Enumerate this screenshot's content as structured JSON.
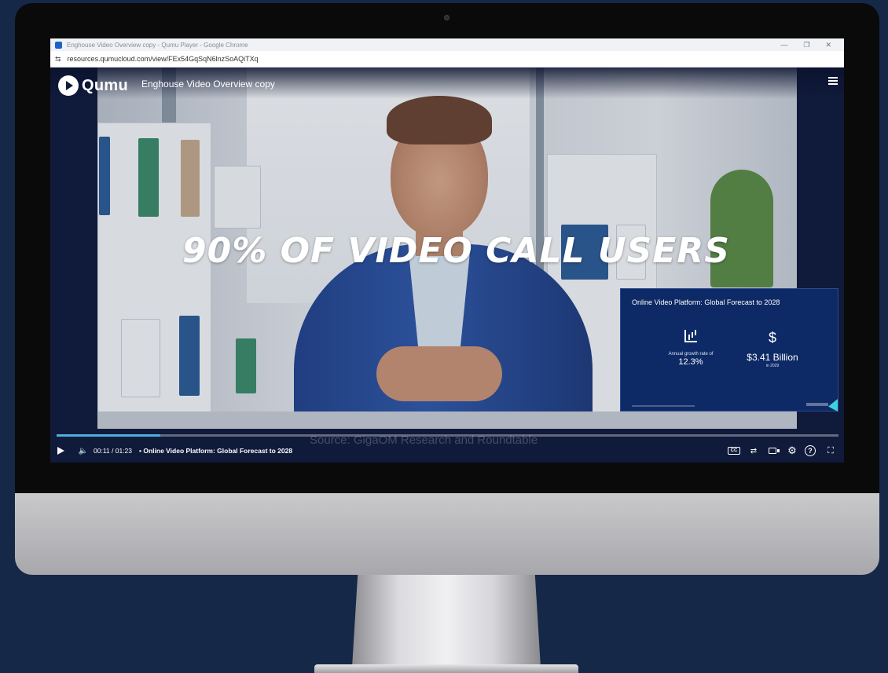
{
  "browser": {
    "window_title": "Enghouse Video Overview copy - Qumu Player - Google Chrome",
    "url": "resources.qumucloud.com/view/FEx54GqSqN6lnzSoAQiTXq",
    "controls": {
      "minimize": "—",
      "restore": "❐",
      "close": "✕"
    }
  },
  "player": {
    "logo_text": "Qumu",
    "video_title": "Enghouse Video Overview copy",
    "menu_icon": "hamburger-menu-icon",
    "overlay_headline": "90% OF VIDEO CALL USERS",
    "overlay_source": "Source: GigaOM Research and Roundtable",
    "progress_fraction": 0.133,
    "current_time": "00:11",
    "duration": "01:23",
    "time_display": "00:11 / 01:23",
    "chapter_separator": "•",
    "chapter_title": "Online Video Platform: Global Forecast to 2028",
    "controls": {
      "play": "play-icon",
      "volume": "🔈",
      "cc": "CC",
      "transcript": "⇄",
      "pip": "pip-icon",
      "settings": "⚙",
      "help": "?",
      "fullscreen": "⛶"
    }
  },
  "stat_card": {
    "title": "Online Video Platform: Global Forecast to 2028",
    "left": {
      "icon": "bar-chart-icon",
      "label": "Annual growth rate of",
      "value": "12.3%"
    },
    "right": {
      "icon": "$",
      "value": "$3.41 Billion",
      "sub": "in 2029"
    }
  },
  "colors": {
    "background": "#152847",
    "player_bg": "#101a3a",
    "card_bg": "#0e2a66",
    "progress": "#4fb0e0",
    "accent": "#3fd0e0"
  }
}
